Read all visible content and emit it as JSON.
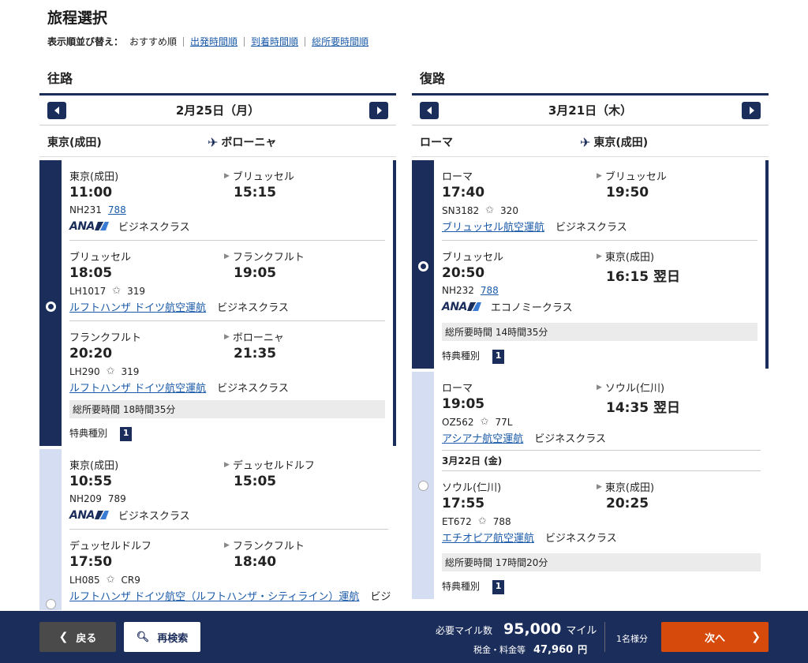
{
  "page": {
    "title": "旅程選択",
    "sort": {
      "label": "表示順並び替え：",
      "current": "おすすめ順",
      "options": [
        "出発時間順",
        "到着時間順",
        "総所要時間順"
      ]
    }
  },
  "outbound": {
    "title": "往路",
    "date": "2月25日（月）",
    "from": "東京(成田)",
    "to": "ボローニャ",
    "options": [
      {
        "segments": [
          {
            "dep_city": "東京(成田)",
            "dep_time": "11:00",
            "arr_city": "ブリュッセル",
            "arr_time": "15:15",
            "flight": "NH231",
            "aircraft": "788",
            "carrier_logo": "ANA",
            "carrier_text": "",
            "cabin": "ビジネスクラス"
          },
          {
            "dep_city": "ブリュッセル",
            "dep_time": "18:05",
            "arr_city": "フランクフルト",
            "arr_time": "19:05",
            "flight": "LH1017",
            "aircraft": "319",
            "carrier_logo": "",
            "carrier_text": "ルフトハンザ ドイツ航空運航",
            "cabin": "ビジネスクラス"
          },
          {
            "dep_city": "フランクフルト",
            "dep_time": "20:20",
            "arr_city": "ボローニャ",
            "arr_time": "21:35",
            "flight": "LH290",
            "aircraft": "319",
            "carrier_logo": "",
            "carrier_text": "ルフトハンザ ドイツ航空運航",
            "cabin": "ビジネスクラス"
          }
        ],
        "total": "総所要時間 18時間35分",
        "award_label": "特典種別",
        "award_badge": "1"
      },
      {
        "segments": [
          {
            "dep_city": "東京(成田)",
            "dep_time": "10:55",
            "arr_city": "デュッセルドルフ",
            "arr_time": "15:05",
            "flight": "NH209",
            "aircraft": "789",
            "carrier_logo": "ANA",
            "carrier_text": "",
            "cabin": "ビジネスクラス"
          },
          {
            "dep_city": "デュッセルドルフ",
            "dep_time": "17:50",
            "arr_city": "フランクフルト",
            "arr_time": "18:40",
            "flight": "LH085",
            "aircraft": "CR9",
            "carrier_logo": "",
            "carrier_text": "ルフトハンザ ドイツ航空（ルフトハンザ・シティライン）運航",
            "cabin": "ビジ"
          }
        ]
      }
    ]
  },
  "return": {
    "title": "復路",
    "date": "3月21日（木）",
    "from": "ローマ",
    "to": "東京(成田)",
    "options": [
      {
        "segments": [
          {
            "dep_city": "ローマ",
            "dep_time": "17:40",
            "arr_city": "ブリュッセル",
            "arr_time": "19:50",
            "flight": "SN3182",
            "aircraft": "320",
            "carrier_logo": "",
            "carrier_text": "ブリュッセル航空運航",
            "cabin": "ビジネスクラス"
          },
          {
            "dep_city": "ブリュッセル",
            "dep_time": "20:50",
            "arr_city": "東京(成田)",
            "arr_time": "16:15 翌日",
            "flight": "NH232",
            "aircraft": "788",
            "carrier_logo": "ANA",
            "carrier_text": "",
            "cabin": "エコノミークラス"
          }
        ],
        "total": "総所要時間 14時間35分",
        "award_label": "特典種別",
        "award_badge": "1"
      },
      {
        "segments": [
          {
            "dep_city": "ローマ",
            "dep_time": "19:05",
            "arr_city": "ソウル(仁川)",
            "arr_time": "14:35 翌日",
            "flight": "OZ562",
            "aircraft": "77L",
            "carrier_logo": "",
            "carrier_text": "アシアナ航空運航",
            "cabin": "ビジネスクラス"
          },
          {
            "dep_city": "ソウル(仁川)",
            "dep_time": "17:55",
            "arr_city": "東京(成田)",
            "arr_time": "20:25",
            "flight": "ET672",
            "aircraft": "788",
            "carrier_logo": "",
            "carrier_text": "エチオピア航空運航",
            "cabin": "ビジネスクラス"
          }
        ],
        "date_sep": "3月22日 (金)",
        "total": "総所要時間 17時間20分",
        "award_label": "特典種別",
        "award_badge": "1"
      }
    ]
  },
  "footer": {
    "back": "戻る",
    "research": "再検索",
    "miles_label": "必要マイル数",
    "miles_value": "95,000",
    "miles_unit": "マイル",
    "tax_label": "税金・料金等",
    "tax_value": "47,960",
    "tax_unit": "円",
    "pax": "1名様分",
    "next": "次へ"
  },
  "colors": {
    "navy": "#1b2d5a",
    "link": "#1a5aa8",
    "next_button": "#d64b0c",
    "unselected_rail": "#d4ddf2"
  }
}
